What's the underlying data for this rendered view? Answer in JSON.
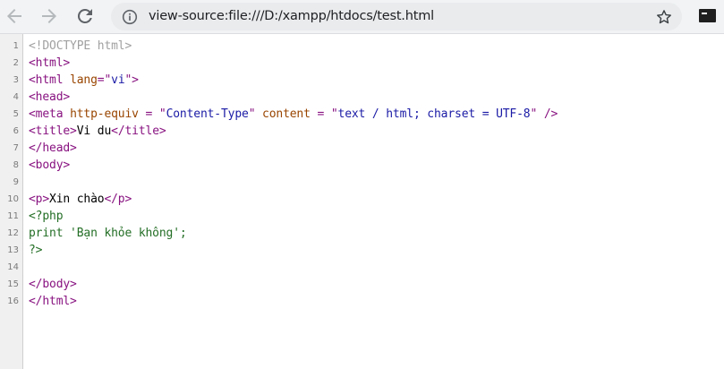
{
  "browser": {
    "url": "view-source:file:///D:/xampp/htdocs/test.html",
    "icons": {
      "back": "arrow-back-icon",
      "forward": "arrow-forward-icon",
      "reload": "reload-icon",
      "site_info": "info-icon",
      "bookmark": "star-icon",
      "extension": "terminal-icon"
    }
  },
  "colors": {
    "tag": "#881280",
    "attribute": "#994500",
    "value": "#1a1aa6",
    "doctype": "#a0a0a0",
    "php": "#236e25"
  },
  "source": {
    "lines": [
      {
        "num": "1",
        "segments": [
          {
            "t": "<!DOCTYPE html>",
            "c": "comment"
          }
        ]
      },
      {
        "num": "2",
        "segments": [
          {
            "t": "<html>",
            "c": "tag"
          }
        ]
      },
      {
        "num": "3",
        "segments": [
          {
            "t": "<html ",
            "c": "tag"
          },
          {
            "t": "lang",
            "c": "attr"
          },
          {
            "t": "=\"",
            "c": "tag"
          },
          {
            "t": "vi",
            "c": "val"
          },
          {
            "t": "\">",
            "c": "tag"
          }
        ]
      },
      {
        "num": "4",
        "segments": [
          {
            "t": "<head>",
            "c": "tag"
          }
        ]
      },
      {
        "num": "5",
        "segments": [
          {
            "t": "<meta ",
            "c": "tag"
          },
          {
            "t": "http-equiv",
            "c": "attr"
          },
          {
            "t": " = \"",
            "c": "tag"
          },
          {
            "t": "Content-Type",
            "c": "val"
          },
          {
            "t": "\" ",
            "c": "tag"
          },
          {
            "t": "content",
            "c": "attr"
          },
          {
            "t": " = \"",
            "c": "tag"
          },
          {
            "t": "text / html; charset = UTF-8",
            "c": "val"
          },
          {
            "t": "\" />",
            "c": "tag"
          }
        ]
      },
      {
        "num": "6",
        "segments": [
          {
            "t": "<title>",
            "c": "tag"
          },
          {
            "t": "Vi du",
            "c": ""
          },
          {
            "t": "</title>",
            "c": "tag"
          }
        ]
      },
      {
        "num": "7",
        "segments": [
          {
            "t": "</head>",
            "c": "tag"
          }
        ]
      },
      {
        "num": "8",
        "segments": [
          {
            "t": "<body>",
            "c": "tag"
          }
        ]
      },
      {
        "num": "9",
        "segments": []
      },
      {
        "num": "10",
        "segments": [
          {
            "t": "<p>",
            "c": "tag"
          },
          {
            "t": "Xin chào",
            "c": ""
          },
          {
            "t": "</p>",
            "c": "tag"
          }
        ]
      },
      {
        "num": "11",
        "segments": [
          {
            "t": "<?php",
            "c": "pi"
          }
        ]
      },
      {
        "num": "12",
        "segments": [
          {
            "t": "print 'Bạn khỏe không';",
            "c": "pi"
          }
        ]
      },
      {
        "num": "13",
        "segments": [
          {
            "t": "?>",
            "c": "pi"
          }
        ]
      },
      {
        "num": "14",
        "segments": []
      },
      {
        "num": "15",
        "segments": [
          {
            "t": "</body>",
            "c": "tag"
          }
        ]
      },
      {
        "num": "16",
        "segments": [
          {
            "t": "</html>",
            "c": "tag"
          }
        ]
      }
    ]
  }
}
